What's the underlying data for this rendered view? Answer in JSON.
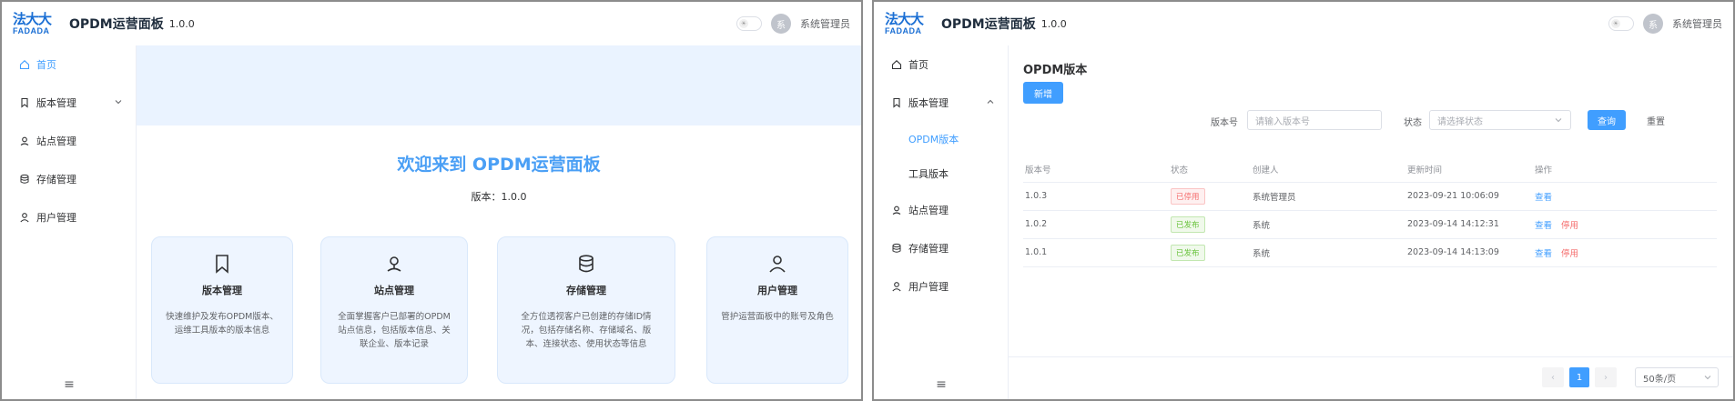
{
  "app": {
    "logo_cn": "法大大",
    "logo_en": "FADADA",
    "title": "OPDM运营面板",
    "version": "1.0.0",
    "user_avatar_text": "系",
    "user_name": "系统管理员",
    "theme_toggle_glyph": "☀"
  },
  "left": {
    "sidebar": {
      "items": [
        {
          "label": "首页",
          "icon": "home-icon"
        },
        {
          "label": "版本管理",
          "icon": "bookmark-icon"
        },
        {
          "label": "站点管理",
          "icon": "location-icon"
        },
        {
          "label": "存储管理",
          "icon": "database-icon"
        },
        {
          "label": "用户管理",
          "icon": "user-icon"
        }
      ],
      "collapse_glyph": "≡"
    },
    "welcome": "欢迎来到 OPDM运营面板",
    "version_line": "版本：1.0.0",
    "cards": [
      {
        "title": "版本管理",
        "desc": "快速维护及发布OPDM版本、运维工具版本的版本信息",
        "icon": "bookmark-icon"
      },
      {
        "title": "站点管理",
        "desc": "全面掌握客户已部署的OPDM站点信息，包括版本信息、关联企业、版本记录",
        "icon": "location-icon"
      },
      {
        "title": "存储管理",
        "desc": "全方位透视客户已创建的存储ID情况，包括存储名称、存储域名、版本、连接状态、使用状态等信息",
        "icon": "database-icon"
      },
      {
        "title": "用户管理",
        "desc": "管护运营面板中的账号及角色",
        "icon": "user-icon"
      }
    ]
  },
  "right": {
    "sidebar": {
      "items": [
        {
          "label": "首页"
        },
        {
          "label": "版本管理"
        },
        {
          "label": "OPDM版本"
        },
        {
          "label": "工具版本"
        },
        {
          "label": "站点管理"
        },
        {
          "label": "存储管理"
        },
        {
          "label": "用户管理"
        }
      ],
      "collapse_glyph": "≡"
    },
    "page_title": "OPDM版本",
    "add_button": "新增",
    "filters": {
      "version_label": "版本号",
      "version_placeholder": "请输入版本号",
      "status_label": "状态",
      "status_placeholder": "请选择状态",
      "query_button": "查询",
      "reset_button": "重置"
    },
    "table": {
      "headers": [
        "版本号",
        "状态",
        "创建人",
        "更新时间",
        "操作"
      ],
      "rows": [
        {
          "version": "1.0.3",
          "status": "已停用",
          "status_kind": "off",
          "creator": "系统管理员",
          "updated": "2023-09-21 10:06:09",
          "action_view": "查看",
          "action_extra": ""
        },
        {
          "version": "1.0.2",
          "status": "已发布",
          "status_kind": "on",
          "creator": "系统",
          "updated": "2023-09-14 14:12:31",
          "action_view": "查看",
          "action_extra": "停用"
        },
        {
          "version": "1.0.1",
          "status": "已发布",
          "status_kind": "on",
          "creator": "系统",
          "updated": "2023-09-14 14:13:09",
          "action_view": "查看",
          "action_extra": "停用"
        }
      ]
    },
    "pagination": {
      "prev": "‹",
      "current": "1",
      "next": "›",
      "page_size": "50条/页"
    }
  },
  "colors": {
    "primary": "#409eff",
    "danger": "#f56c6c",
    "success": "#67c23a",
    "brand": "#1b6fd4"
  }
}
